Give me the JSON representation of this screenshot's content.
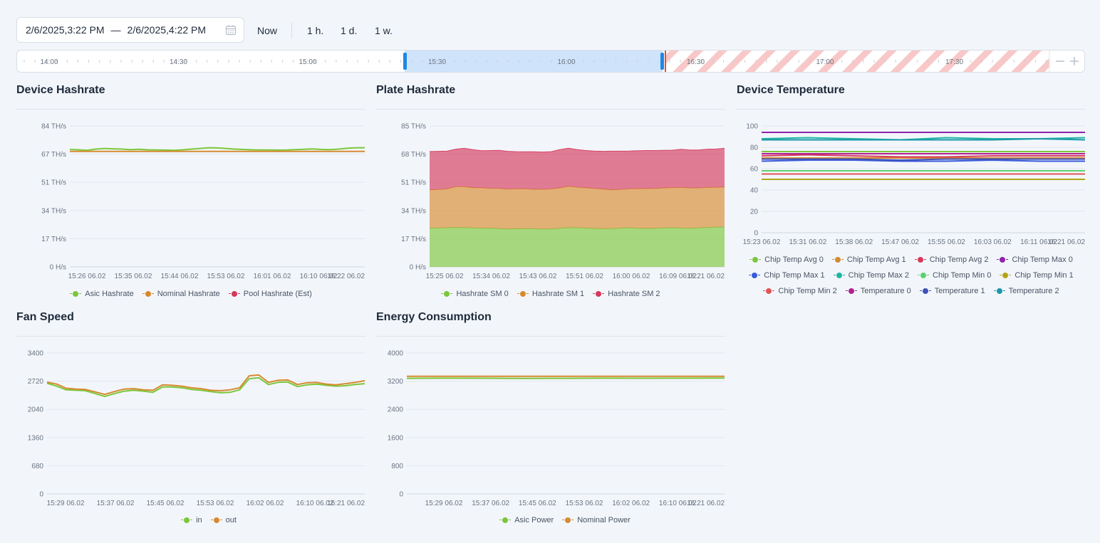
{
  "toolbar": {
    "range_start": "2/6/2025,3:22 PM",
    "range_separator": "—",
    "range_end": "2/6/2025,4:22 PM",
    "calendar_icon": "calendar-icon",
    "quick_now": "Now",
    "quick_1h": "1 h.",
    "quick_1d": "1 d.",
    "quick_1w": "1 w."
  },
  "timeline": {
    "ticks": [
      "14:00",
      "14:30",
      "15:00",
      "15:30",
      "16:00",
      "16:30",
      "17:00",
      "17:30"
    ],
    "selection_start": "15:22",
    "selection_end": "16:22",
    "now_marker": "16:23",
    "zoom_out_icon": "minus-icon",
    "zoom_in_icon": "plus-icon",
    "selection_color": "#cfe4fb",
    "handle_color": "#1e88e5",
    "future_hatch_color": "#f8c8c8"
  },
  "charts": {
    "device_hashrate": {
      "title": "Device Hashrate",
      "chart_data": {
        "type": "line",
        "y_ticks": [
          "0 H/s",
          "17 TH/s",
          "34 TH/s",
          "51 TH/s",
          "67 TH/s",
          "84 TH/s"
        ],
        "ylim": [
          0,
          84
        ],
        "x_ticks": [
          "15:26 06.02",
          "15:35 06.02",
          "15:44 06.02",
          "15:53 06.02",
          "16:01 06.02",
          "16:10 06.02",
          "16:22 06.02"
        ],
        "series": [
          {
            "name": "Asic Hashrate",
            "color": "#7cc63b",
            "values": [
              70.0,
              69.8,
              69.5,
              70.2,
              70.6,
              70.4,
              70.2,
              69.9,
              70.1,
              69.8,
              69.7,
              69.6,
              69.5,
              69.8,
              70.2,
              70.6,
              71.0,
              70.9,
              70.6,
              70.2,
              70.0,
              69.8,
              69.7,
              69.7,
              69.6,
              69.7,
              69.9,
              70.1,
              70.3,
              70.0,
              69.9,
              70.2,
              70.7,
              71.0,
              71.0
            ]
          },
          {
            "name": "Nominal Hashrate",
            "color": "#d78a2f",
            "values": [
              68.8,
              68.8
            ]
          },
          {
            "name": "Pool Hashrate (Est)",
            "color": "#d6395c",
            "values": []
          }
        ]
      }
    },
    "plate_hashrate": {
      "title": "Plate Hashrate",
      "chart_data": {
        "type": "area",
        "stacked": true,
        "y_ticks": [
          "0 H/s",
          "17 TH/s",
          "34 TH/s",
          "51 TH/s",
          "68 TH/s",
          "85 TH/s"
        ],
        "ylim": [
          0,
          85
        ],
        "x_ticks": [
          "15:25 06.02",
          "15:34 06.02",
          "15:43 06.02",
          "15:51 06.02",
          "16:00 06.02",
          "16:09 06.02",
          "16:21 06.02"
        ],
        "series": [
          {
            "name": "Hashrate SM 0",
            "color": "#7cc63b",
            "values": [
              23.5,
              23.4,
              23.6,
              23.8,
              23.7,
              23.5,
              23.3,
              23.4,
              23.1,
              22.9,
              23.0,
              23.1,
              23.0,
              22.8,
              22.9,
              23.3,
              23.7,
              23.6,
              23.4,
              23.2,
              23.0,
              23.1,
              23.4,
              23.6,
              23.3,
              23.2,
              23.3,
              23.5,
              23.6,
              23.4,
              23.3,
              23.5,
              23.8,
              24.0,
              24.1
            ]
          },
          {
            "name": "Hashrate SM 1",
            "color": "#d78a2f",
            "values": [
              23.0,
              23.3,
              23.4,
              24.6,
              24.7,
              24.2,
              24.4,
              24.0,
              24.2,
              24.0,
              24.1,
              24.0,
              23.8,
              24.0,
              24.1,
              24.3,
              24.9,
              24.5,
              24.3,
              24.1,
              23.9,
              23.4,
              23.3,
              23.5,
              23.9,
              24.0,
              24.0,
              24.1,
              24.2,
              24.5,
              24.3,
              24.1,
              24.2,
              24.0,
              24.1
            ]
          },
          {
            "name": "Hashrate SM 2",
            "color": "#d6395c",
            "values": [
              23.1,
              23.0,
              22.8,
              22.6,
              23.1,
              23.0,
              22.4,
              22.8,
              23.0,
              22.8,
              22.4,
              22.3,
              22.6,
              22.5,
              22.5,
              23.1,
              23.0,
              22.7,
              22.5,
              22.6,
              22.8,
              23.3,
              23.1,
              22.8,
              22.9,
              23.0,
              22.9,
              22.7,
              22.6,
              23.0,
              22.9,
              22.9,
              23.0,
              23.1,
              23.3
            ]
          }
        ]
      }
    },
    "device_temperature": {
      "title": "Device Temperature",
      "chart_data": {
        "type": "line",
        "y_ticks": [
          "0",
          "20",
          "40",
          "60",
          "80",
          "100"
        ],
        "ylim": [
          0,
          100
        ],
        "x_ticks": [
          "15:23 06.02",
          "15:31 06.02",
          "15:38 06.02",
          "15:47 06.02",
          "15:55 06.02",
          "16:03 06.02",
          "16:11 06.02",
          "16:21 06.02"
        ],
        "series": [
          {
            "name": "Chip Temp Avg 0",
            "color": "#7cc63b",
            "values": [
              76,
              76
            ]
          },
          {
            "name": "Chip Temp Avg 1",
            "color": "#d78a2f",
            "values": [
              70,
              70
            ]
          },
          {
            "name": "Chip Temp Avg 2",
            "color": "#d6395c",
            "values": [
              72,
              73,
              72,
              71,
              71,
              72,
              72,
              72
            ]
          },
          {
            "name": "Chip Temp Max 0",
            "color": "#8e24aa",
            "values": [
              94,
              94
            ]
          },
          {
            "name": "Chip Temp Max 1",
            "color": "#3b5bdb",
            "values": [
              67,
              68,
              68,
              67,
              67,
              68,
              67,
              67
            ]
          },
          {
            "name": "Chip Temp Max 2",
            "color": "#1fb5a3",
            "values": [
              88,
              89,
              88,
              87,
              89,
              88,
              88,
              89
            ]
          },
          {
            "name": "Chip Temp Min 0",
            "color": "#5bd16b",
            "values": [
              58,
              58
            ]
          },
          {
            "name": "Chip Temp Min 1",
            "color": "#b5a316",
            "values": [
              50,
              50
            ]
          },
          {
            "name": "Chip Temp Min 2",
            "color": "#e05555",
            "values": [
              55,
              55
            ]
          },
          {
            "name": "Temperature 0",
            "color": "#b0208f",
            "values": [
              74,
              74
            ]
          },
          {
            "name": "Temperature 1",
            "color": "#3f51b5",
            "values": [
              69,
              69,
              69,
              68,
              69,
              69,
              69,
              69
            ]
          },
          {
            "name": "Temperature 2",
            "color": "#1c98a8",
            "values": [
              87,
              87,
              87,
              87,
              87,
              87,
              88,
              87
            ]
          }
        ]
      }
    },
    "fan_speed": {
      "title": "Fan Speed",
      "chart_data": {
        "type": "line",
        "y_ticks": [
          "0",
          "680",
          "1360",
          "2040",
          "2720",
          "3400"
        ],
        "ylim": [
          0,
          3400
        ],
        "x_ticks": [
          "15:29 06.02",
          "15:37 06.02",
          "15:45 06.02",
          "15:53 06.02",
          "16:02 06.02",
          "16:10 06.02",
          "16:21 06.02"
        ],
        "series": [
          {
            "name": "in",
            "color": "#7cc63b",
            "values": [
              2670,
              2600,
              2510,
              2500,
              2490,
              2420,
              2350,
              2420,
              2480,
              2500,
              2480,
              2450,
              2580,
              2580,
              2560,
              2520,
              2500,
              2470,
              2440,
              2450,
              2510,
              2780,
              2800,
              2640,
              2690,
              2700,
              2590,
              2630,
              2650,
              2620,
              2600,
              2610,
              2640,
              2660
            ]
          },
          {
            "name": "out",
            "color": "#d78a2f",
            "values": [
              2700,
              2650,
              2550,
              2530,
              2520,
              2460,
              2400,
              2470,
              2530,
              2540,
              2510,
              2500,
              2630,
              2620,
              2600,
              2560,
              2540,
              2500,
              2490,
              2510,
              2560,
              2850,
              2870,
              2690,
              2740,
              2750,
              2640,
              2680,
              2690,
              2650,
              2630,
              2660,
              2690,
              2730
            ]
          }
        ]
      }
    },
    "energy_consumption": {
      "title": "Energy Consumption",
      "chart_data": {
        "type": "line",
        "y_ticks": [
          "0",
          "800",
          "1600",
          "2400",
          "3200",
          "4000"
        ],
        "ylim": [
          0,
          4000
        ],
        "x_ticks": [
          "15:29 06.02",
          "15:37 06.02",
          "15:45 06.02",
          "15:53 06.02",
          "16:02 06.02",
          "16:10 06.02",
          "16:21 06.02"
        ],
        "series": [
          {
            "name": "Asic Power",
            "color": "#7cc63b",
            "values": [
              3280,
              3285,
              3282,
              3279,
              3281,
              3284,
              3283,
              3285,
              3287
            ]
          },
          {
            "name": "Nominal Power",
            "color": "#d78a2f",
            "values": [
              3340,
              3340
            ]
          }
        ]
      }
    }
  }
}
